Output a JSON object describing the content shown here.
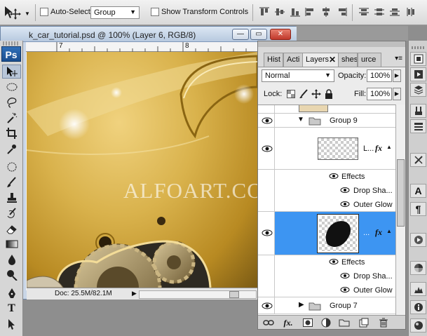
{
  "options_bar": {
    "auto_select_label": "Auto-Select:",
    "auto_select_value": "Group",
    "show_transform_label": "Show Transform Controls"
  },
  "toolbox": {
    "logo": "Ps",
    "tools": [
      "move-tool",
      "marquee-tool",
      "lasso-tool",
      "magic-wand-tool",
      "crop-tool",
      "eyedropper-tool",
      "healing-brush-tool",
      "brush-tool",
      "clone-stamp-tool",
      "history-brush-tool",
      "eraser-tool",
      "gradient-tool",
      "blur-tool",
      "dodge-tool",
      "pen-tool",
      "type-tool",
      "path-selection-tool"
    ]
  },
  "document": {
    "title": "k_car_tutorial.psd @ 100% (Layer 6, RGB/8)",
    "ruler_marks": [
      "7",
      "8"
    ],
    "watermark": "ALFOART.COM",
    "doc_size": "Doc: 25.5M/82.1M"
  },
  "layers_panel": {
    "tabs": [
      "Hist",
      "Acti",
      "Layers",
      "shes",
      "urce"
    ],
    "blend_mode": "Normal",
    "opacity_label": "Opacity:",
    "opacity_value": "100%",
    "lock_label": "Lock:",
    "fill_label": "Fill:",
    "fill_value": "100%",
    "rows": {
      "group9": "Group 9",
      "layer_l": "L...",
      "effects_1": "Effects",
      "drop_shadow_1": "Drop Sha...",
      "outer_glow_1": "Outer Glow",
      "layer6": "...",
      "effects_2": "Effects",
      "drop_shadow_2": "Drop Sha...",
      "outer_glow_2": "Outer Glow",
      "group7": "Group 7"
    }
  },
  "colors": {
    "selection": "#3d95f2",
    "canvas_gold": "#d9b24c"
  }
}
